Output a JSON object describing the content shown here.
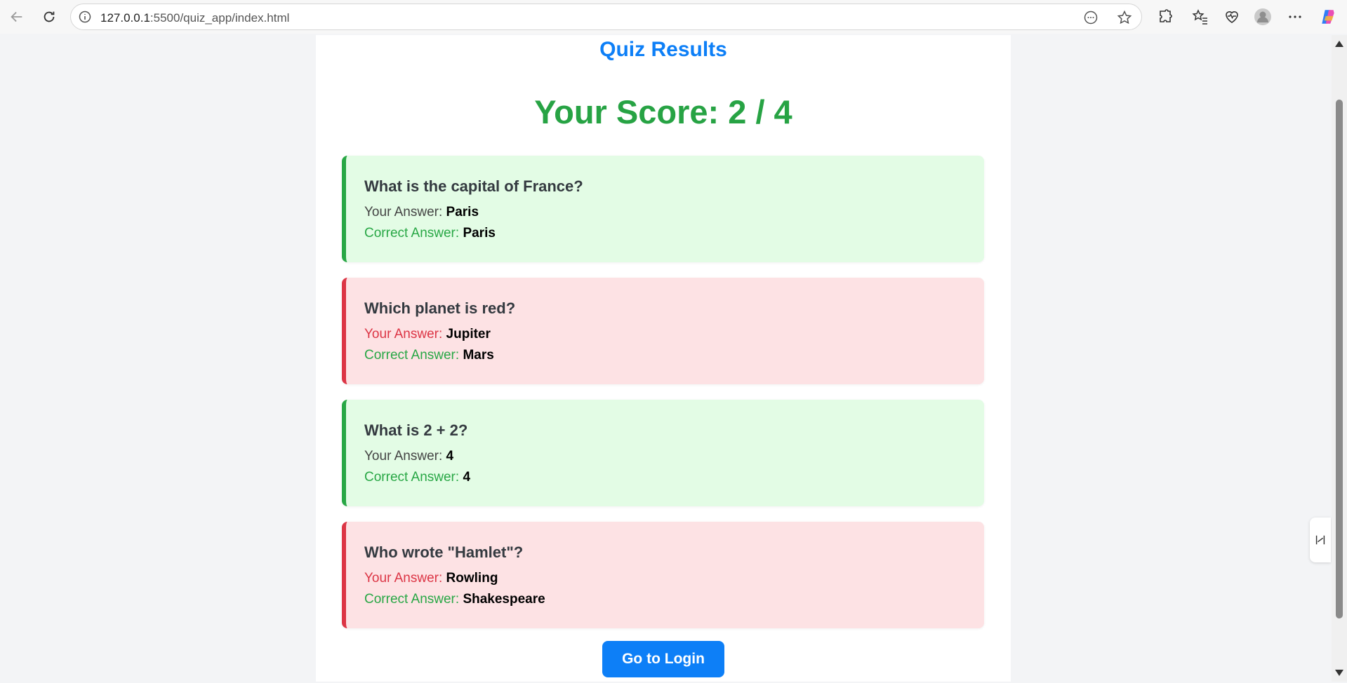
{
  "browser": {
    "url_host": "127.0.0.1",
    "url_path": ":5500/quiz_app/index.html"
  },
  "page": {
    "title": "Quiz Results",
    "score_text": "Your Score: 2 / 4",
    "your_answer_label": "Your Answer: ",
    "correct_answer_label": "Correct Answer: ",
    "button_label": "Go to Login"
  },
  "results": [
    {
      "question": "What is the capital of France?",
      "your_answer": "Paris",
      "correct_answer": "Paris",
      "status": "correct"
    },
    {
      "question": "Which planet is red?",
      "your_answer": "Jupiter",
      "correct_answer": "Mars",
      "status": "wrong"
    },
    {
      "question": "What is 2 + 2?",
      "your_answer": "4",
      "correct_answer": "4",
      "status": "correct"
    },
    {
      "question": "Who wrote \"Hamlet\"?",
      "your_answer": "Rowling",
      "correct_answer": "Shakespeare",
      "status": "wrong"
    }
  ],
  "colors": {
    "accent_blue": "#0d7ff7",
    "score_green": "#27a344",
    "correct_bg": "#e3fce5",
    "wrong_bg": "#fde2e4",
    "correct_border": "#28a745",
    "wrong_border": "#dc3545"
  }
}
